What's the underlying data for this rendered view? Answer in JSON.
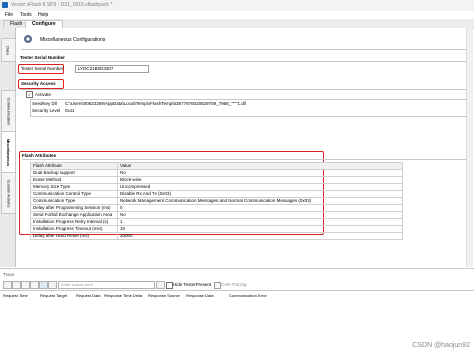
{
  "window": {
    "title": "Vector vFlash 6 SP3 - D31_0315.vflashpack *"
  },
  "menu": {
    "items": [
      "File",
      "Tools",
      "Help"
    ]
  },
  "tabs": {
    "items": [
      "Flash",
      "Configure"
    ],
    "active": 1
  },
  "side_tabs": {
    "items": [
      "Data",
      "Communication",
      "Miscellaneous",
      "Custom Actions"
    ],
    "active": 2
  },
  "misc": {
    "header": "Miscellaneous Configurations",
    "tester_serial": {
      "section": "Tester Serial Number",
      "label": "Tester Serial Number:",
      "value": "LYDC21B0D3307"
    },
    "security": {
      "section": "Security Access",
      "activate_label": "Activate",
      "seedkey_label": "SeedKey Dll",
      "seedkey_value": "C:\\Users\\00622269\\AppData\\Local\\Temp\\vFlashTemp\\63877976020829759_7968_\"\"\"\"1.dll",
      "level_label": "Security Level",
      "level_value": "0x11"
    },
    "flash_attributes": {
      "section": "Flash Attributes",
      "columns": [
        "Flash Attribute",
        "Value"
      ],
      "rows": [
        [
          "Dual Backup support",
          "No"
        ],
        [
          "Erase Method",
          "Block-wise"
        ],
        [
          "Memory Size Type",
          "Uncompressed"
        ],
        [
          "Communication Control Type",
          "Disable Rx And Tx (0x03)"
        ],
        [
          "Communication Type",
          "Network Management Communication Messages and Normal Communication Messages (0x03)"
        ],
        [
          "Delay after Programming Session (ms)",
          "0"
        ],
        [
          "Send Forbid Exchange Application Area",
          "No"
        ],
        [
          "Installation Progress Retry Interval (s)",
          "1"
        ],
        [
          "Installation Progress Timeout (min)",
          "10"
        ],
        [
          "Delay after Hard Reset (ms)",
          "20000"
        ]
      ]
    }
  },
  "trace": {
    "title": "Trace",
    "search_placeholder": "Enter search term",
    "hide_testerpresent": "Hide TesterPresent",
    "can_tracing": "CAN Tracing",
    "columns": [
      "Request Time",
      "Request Target",
      "Request Data",
      "Response Time Delta",
      "Response Source",
      "Response Data",
      "Communication Error"
    ]
  },
  "watermark": "CSDN @haojun92",
  "colors": {
    "highlight_box": "#e02020",
    "accent": "#1a66b5"
  }
}
